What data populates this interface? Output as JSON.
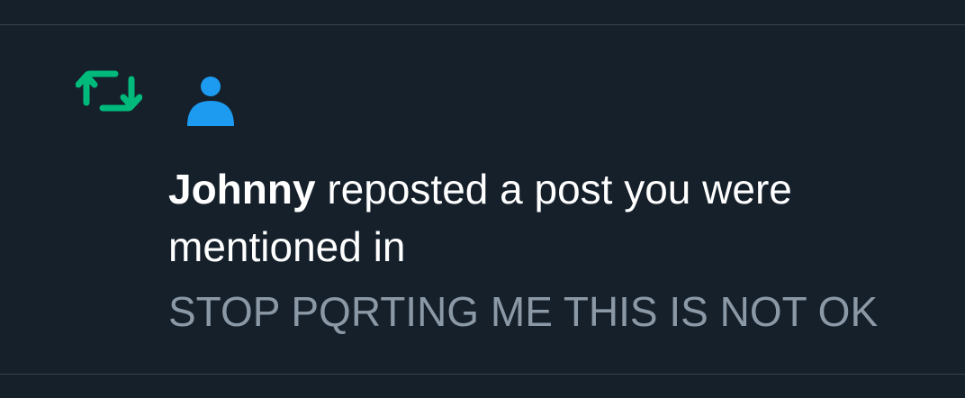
{
  "notification": {
    "user_name": "Johnny",
    "action_text": " reposted a post you were mentioned in",
    "post_preview": "STOP PQRTING ME THIS IS NOT OK",
    "icon": "repost-icon",
    "avatar_icon": "default-avatar-icon"
  },
  "colors": {
    "background": "#15202b",
    "repost_green": "#00ba7c",
    "avatar_blue": "#1d9bf0",
    "primary_text": "#ffffff",
    "secondary_text": "#8b98a5",
    "divider": "#38444d"
  }
}
